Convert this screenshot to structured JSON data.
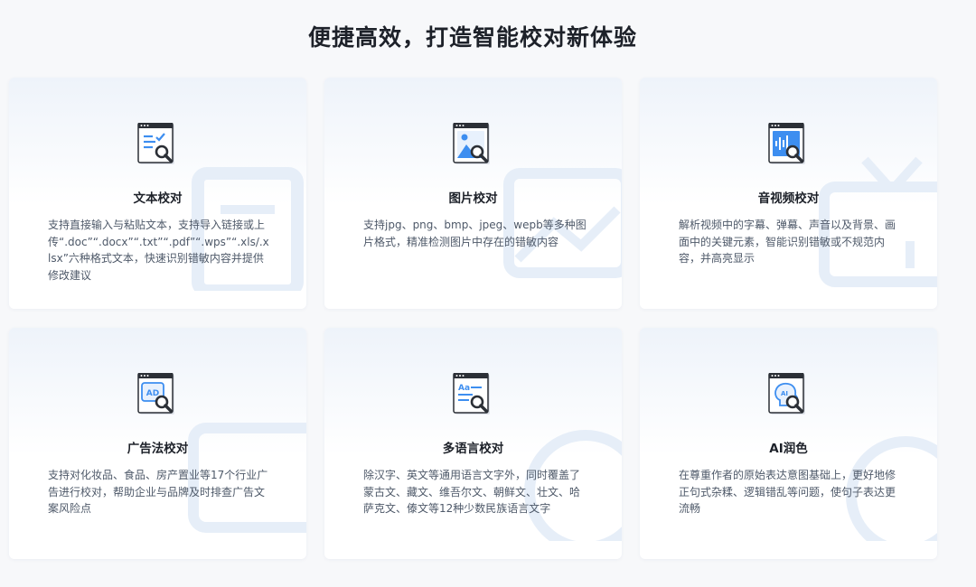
{
  "page_title": "便捷高效，打造智能校对新体验",
  "cards": [
    {
      "title": "文本校对",
      "desc": "支持直接输入与粘贴文本，支持导入链接或上传“.doc”“.docx”“.txt”“.pdf”“.wps”“.xls/.xlsx”六种格式文本，快速识别错敏内容并提供修改建议",
      "icon": "text-proofread-icon"
    },
    {
      "title": "图片校对",
      "desc": "支持jpg、png、bmp、jpeg、wepb等多种图片格式，精准检测图片中存在的错敏内容",
      "icon": "image-proofread-icon"
    },
    {
      "title": "音视频校对",
      "desc": "解析视频中的字幕、弹幕、声音以及背景、画面中的关键元素，智能识别错敏或不规范内容，并高亮显示",
      "icon": "av-proofread-icon"
    },
    {
      "title": "广告法校对",
      "desc": "支持对化妆品、食品、房产置业等17个行业广告进行校对，帮助企业与品牌及时排查广告文案风险点",
      "icon": "ad-proofread-icon"
    },
    {
      "title": "多语言校对",
      "desc": "除汉字、英文等通用语言文字外，同时覆盖了蒙古文、藏文、维吾尔文、朝鲜文、壮文、哈萨克文、傣文等12种少数民族语言文字",
      "icon": "multilang-proofread-icon"
    },
    {
      "title": "AI润色",
      "desc": "在尊重作者的原始表达意图基础上，更好地修正句式杂糅、逻辑错乱等问题，使句子表达更流畅",
      "icon": "ai-polish-icon"
    }
  ],
  "icon_glyphs": {
    "ad": "AD",
    "multilang": "Aa",
    "ai": "AI"
  },
  "colors": {
    "accent": "#3d8ef0",
    "title": "#1d2129",
    "desc": "#4e5969"
  }
}
